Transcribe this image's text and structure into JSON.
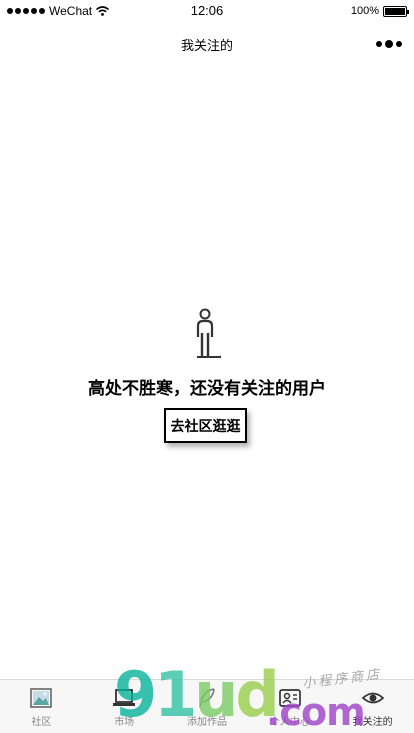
{
  "status_bar": {
    "carrier": "WeChat",
    "time": "12:06",
    "battery": "100%",
    "battery_level": 1.0
  },
  "nav": {
    "title": "我关注的"
  },
  "empty_state": {
    "message": "高处不胜寒，还没有关注的用户",
    "button_label": "去社区逛逛",
    "icon": "person-icon"
  },
  "tab_bar": {
    "items": [
      {
        "label": "社区",
        "icon": "picture-icon"
      },
      {
        "label": "市场",
        "icon": "laptop-icon"
      },
      {
        "label": "添加作品",
        "icon": "feather-icon"
      },
      {
        "label": "个人中心",
        "icon": "id-card-icon"
      },
      {
        "label": "我关注的",
        "icon": "eye-icon"
      }
    ],
    "active_index": 4
  },
  "watermark": {
    "digits": [
      "9",
      "1",
      "u",
      "d"
    ],
    "domain": ".com",
    "caption": "小程序商店"
  }
}
